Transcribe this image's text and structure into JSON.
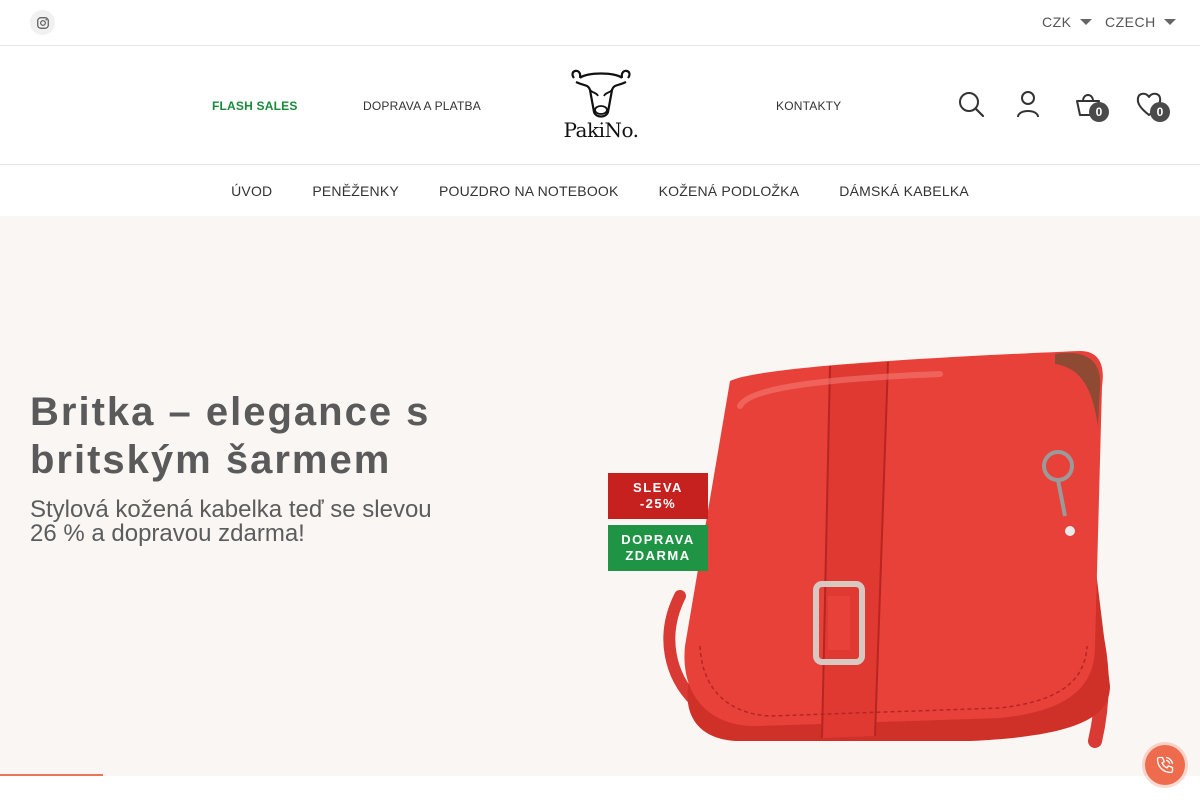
{
  "topbar": {
    "currency": "CZK",
    "language": "CZECH"
  },
  "header": {
    "links": {
      "flash": "FLASH SALES",
      "shipping": "DOPRAVA A PLATBA",
      "contact": "KONTAKTY"
    },
    "logo_text": "PakiNo.",
    "cart_count": "0",
    "wishlist_count": "0"
  },
  "nav": {
    "items": [
      "ÚVOD",
      "PENĚŽENKY",
      "POUZDRO NA NOTEBOOK",
      "KOŽENÁ PODLOŽKA",
      "DÁMSKÁ KABELKA"
    ]
  },
  "hero": {
    "title": "Britka – elegance s britským šarmem",
    "subtitle": "Stylová kožená kabelka teď se slevou 26 % a dopravou zdarma!",
    "promo_sale_line1": "SLEVA",
    "promo_sale_line2": "-25%",
    "promo_free_line1": "DOPRAVA",
    "promo_free_line2": "ZDARMA",
    "slider_progress": 0.086
  },
  "colors": {
    "flash_green": "#1a8a3a",
    "sale_red": "#c6201f",
    "free_green": "#1f9445",
    "accent": "#ee6c4d",
    "bag_red": "#e8413a"
  }
}
